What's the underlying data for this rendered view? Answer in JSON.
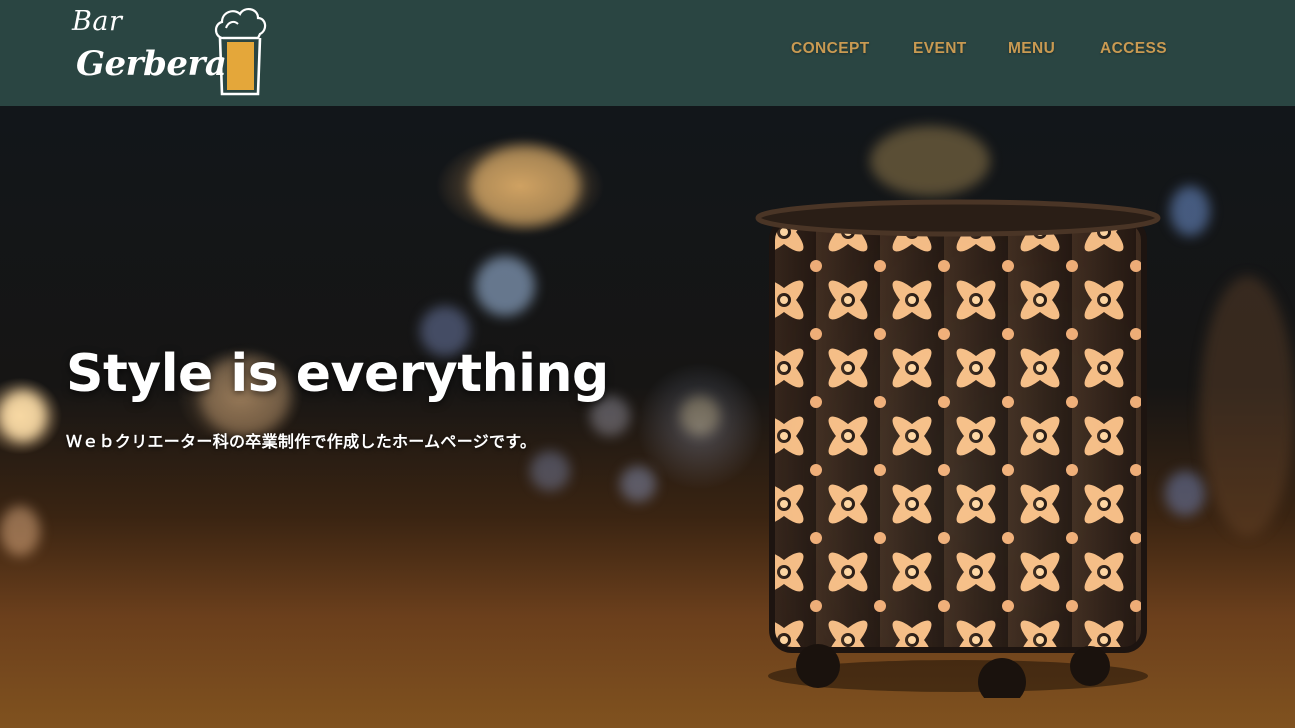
{
  "brand": {
    "line1": "Bar",
    "line2": "Gerbera",
    "icon": "beer-glass-icon"
  },
  "nav": {
    "items": [
      {
        "label": "CONCEPT"
      },
      {
        "label": "EVENT"
      },
      {
        "label": "MENU"
      },
      {
        "label": "ACCESS"
      }
    ]
  },
  "hero": {
    "title": "Style is everything",
    "subtitle": "Ｗｅｂクリエーター科の卒業制作で作成したホームページです。"
  },
  "colors": {
    "header_bg": "#2a4542",
    "nav_text": "#c99a52",
    "beer": "#e4a73a"
  }
}
